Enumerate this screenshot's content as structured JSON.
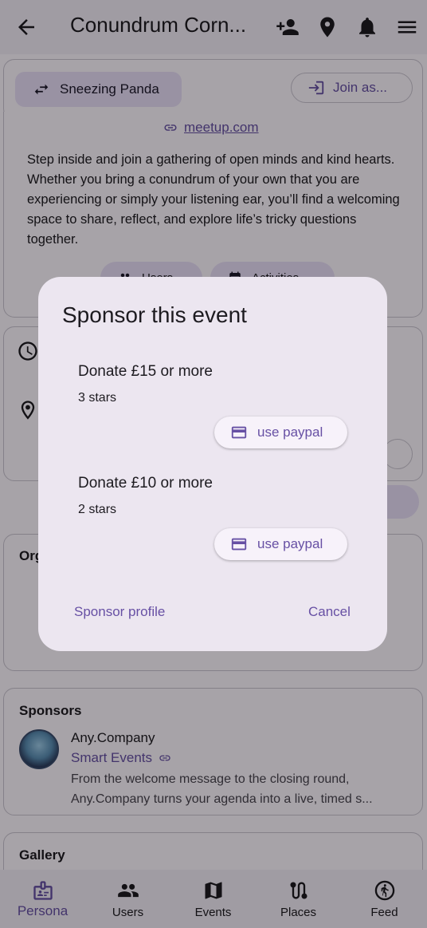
{
  "appbar": {
    "title": "Conundrum Corn...",
    "icons": [
      "back-arrow-icon",
      "person-add-icon",
      "location-pin-icon",
      "bell-icon",
      "menu-icon"
    ]
  },
  "header_card": {
    "persona_chip": "Sneezing Panda",
    "join_button": "Join as...",
    "link_text": "meetup.com"
  },
  "description": "Step inside and join a gathering of open minds and kind hearts. Whether you bring a conundrum of your own that you are experiencing or simply your listening ear, you’ll find a welcoming space to share, reflect, and explore life’s tricky questions together.",
  "tabs": {
    "users": "Users",
    "activities": "Activities"
  },
  "organisers": {
    "title": "Org"
  },
  "sponsors": {
    "title": "Sponsors",
    "company": "Any.Company",
    "event_link": "Smart Events",
    "description": "From the welcome message to the closing round, Any.Company turns your agenda into a live, timed s..."
  },
  "gallery": {
    "title": "Gallery"
  },
  "dialog": {
    "title": "Sponsor this event",
    "tiers": [
      {
        "title": "Donate £15 or more",
        "subtitle": "3 stars",
        "button": "use paypal"
      },
      {
        "title": "Donate £10 or more",
        "subtitle": "2 stars",
        "button": "use paypal"
      }
    ],
    "sponsor_profile": "Sponsor profile",
    "cancel": "Cancel"
  },
  "bottom_nav": {
    "items": [
      {
        "label": "Persona",
        "icon": "badge-icon",
        "active": true
      },
      {
        "label": "Users",
        "icon": "group-icon"
      },
      {
        "label": "Events",
        "icon": "map-icon"
      },
      {
        "label": "Places",
        "icon": "route-icon"
      },
      {
        "label": "Feed",
        "icon": "run-circle-icon"
      }
    ]
  },
  "colors": {
    "accent": "#6750a4",
    "surface": "#fdf7ff",
    "dialog": "#ece6f0"
  }
}
